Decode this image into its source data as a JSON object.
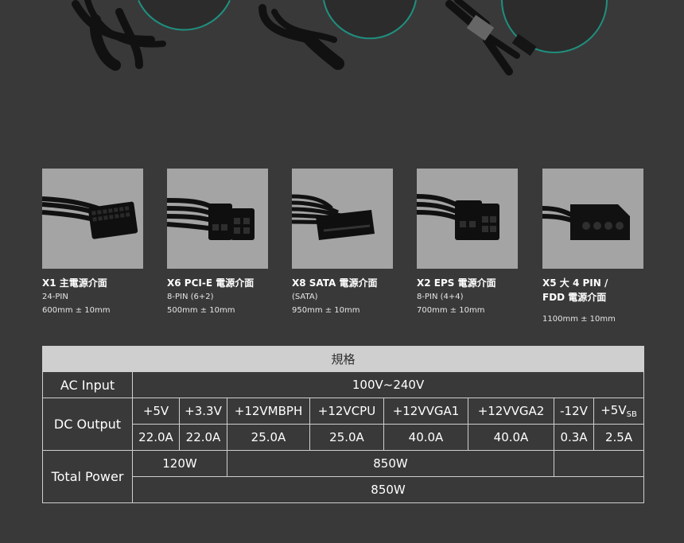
{
  "cards": [
    {
      "title": "X1 主電源介面",
      "line1": "24-PIN",
      "line2": "600mm ± 10mm"
    },
    {
      "title": "X6 PCI-E 電源介面",
      "line1": "8-PIN (6+2)",
      "line2": "500mm ± 10mm"
    },
    {
      "title": "X8 SATA 電源介面",
      "line1": "(SATA)",
      "line2": "950mm ± 10mm"
    },
    {
      "title": "X2 EPS 電源介面",
      "line1": "8-PIN (4+4)",
      "line2": "700mm ± 10mm"
    },
    {
      "title": "X5 大 4 PIN /",
      "title2": "FDD 電源介面",
      "line2": "1100mm ± 10mm"
    }
  ],
  "spec": {
    "heading": "規格",
    "ac_label": "AC Input",
    "ac_value": "100V~240V",
    "dc_label": "DC Output",
    "rails": [
      "+5V",
      "+3.3V",
      "+12VMBPH",
      "+12VCPU",
      "+12VVGA1",
      "+12VVGA2",
      "-12V",
      "+5V"
    ],
    "rail_last_sub": "SB",
    "currents": [
      "22.0A",
      "22.0A",
      "25.0A",
      "25.0A",
      "40.0A",
      "40.0A",
      "0.3A",
      "2.5A"
    ],
    "total_label": "Total Power",
    "total_a": "120W",
    "total_b": "850W",
    "total_all": "850W"
  }
}
